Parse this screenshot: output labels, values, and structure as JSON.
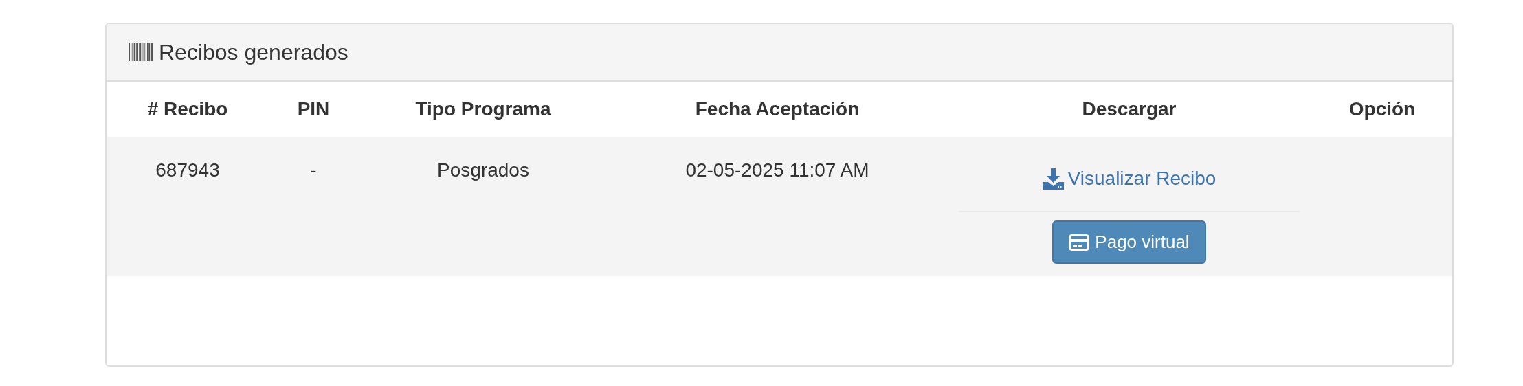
{
  "panel": {
    "title": "Recibos generados"
  },
  "table": {
    "columns": [
      "# Recibo",
      "PIN",
      "Tipo Programa",
      "Fecha Aceptación",
      "Descargar",
      "Opción"
    ],
    "rows": [
      {
        "receipt": "687943",
        "pin": "-",
        "program_type": "Posgrados",
        "accepted_date": "02-05-2025 11:07 AM",
        "download_link": "Visualizar Recibo",
        "pay_button": "Pago virtual"
      }
    ]
  }
}
